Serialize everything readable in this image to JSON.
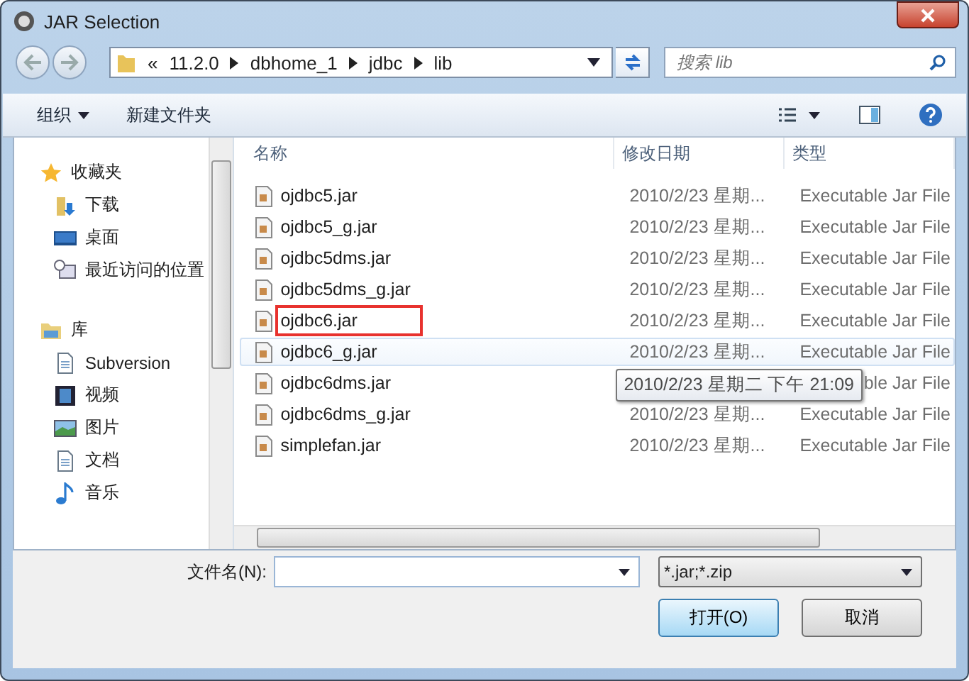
{
  "window": {
    "title": "JAR Selection"
  },
  "address": {
    "prefix": "«",
    "crumbs": [
      "11.2.0",
      "dbhome_1",
      "jdbc",
      "lib"
    ]
  },
  "search": {
    "placeholder": "搜索 lib"
  },
  "toolbar": {
    "organize": "组织",
    "new_folder": "新建文件夹"
  },
  "sidebar": [
    {
      "label": "收藏夹",
      "kind": "star",
      "children": [
        {
          "label": "下载",
          "kind": "download"
        },
        {
          "label": "桌面",
          "kind": "desktop"
        },
        {
          "label": "最近访问的位置",
          "kind": "recent"
        }
      ]
    },
    {
      "label": "库",
      "kind": "library",
      "children": [
        {
          "label": "Subversion",
          "kind": "doc"
        },
        {
          "label": "视频",
          "kind": "video"
        },
        {
          "label": "图片",
          "kind": "image"
        },
        {
          "label": "文档",
          "kind": "doc"
        },
        {
          "label": "音乐",
          "kind": "music"
        }
      ]
    }
  ],
  "table": {
    "columns": [
      "名称",
      "修改日期",
      "类型"
    ],
    "rows": [
      {
        "name": "ojdbc5.jar",
        "date": "2010/2/23 星期...",
        "type": "Executable Jar File",
        "hovered": false,
        "highlighted": false
      },
      {
        "name": "ojdbc5_g.jar",
        "date": "2010/2/23 星期...",
        "type": "Executable Jar File",
        "hovered": false,
        "highlighted": false
      },
      {
        "name": "ojdbc5dms.jar",
        "date": "2010/2/23 星期...",
        "type": "Executable Jar File",
        "hovered": false,
        "highlighted": false
      },
      {
        "name": "ojdbc5dms_g.jar",
        "date": "2010/2/23 星期...",
        "type": "Executable Jar File",
        "hovered": false,
        "highlighted": false
      },
      {
        "name": "ojdbc6.jar",
        "date": "2010/2/23 星期...",
        "type": "Executable Jar File",
        "hovered": false,
        "highlighted": true
      },
      {
        "name": "ojdbc6_g.jar",
        "date": "2010/2/23 星期...",
        "type": "Executable Jar File",
        "hovered": true,
        "highlighted": false
      },
      {
        "name": "ojdbc6dms.jar",
        "type": "ble Jar File",
        "tooltip": "2010/2/23 星期二 下午 21:09",
        "hovered": false,
        "highlighted": false
      },
      {
        "name": "ojdbc6dms_g.jar",
        "date": "2010/2/23 星期...",
        "type": "Executable Jar File",
        "hovered": false,
        "highlighted": false
      },
      {
        "name": "simplefan.jar",
        "date": "2010/2/23 星期...",
        "type": "Executable Jar File",
        "hovered": false,
        "highlighted": false
      }
    ]
  },
  "file_name": {
    "label": "文件名(N):"
  },
  "filter": {
    "value": "*.jar;*.zip"
  },
  "buttons": [
    "打开(O)",
    "取消"
  ]
}
